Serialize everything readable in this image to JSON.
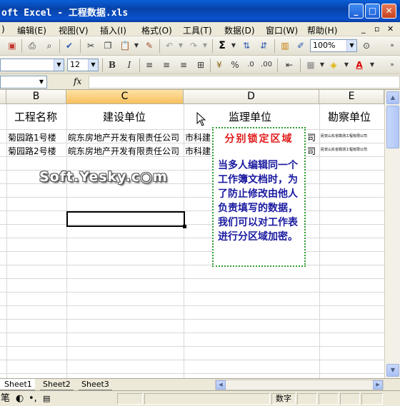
{
  "window": {
    "title": "oft Excel - 工程数据.xls",
    "buttons": [
      "_",
      "□",
      "✕"
    ]
  },
  "menu": {
    "items": [
      "编辑(E)",
      "视图(V)",
      "插入(I)",
      "格式(O)",
      "工具(T)",
      "数据(D)",
      "窗口(W)",
      "帮助(H)"
    ],
    "partial_left": ")",
    "mdi_controls": [
      "_",
      "▫",
      "✕"
    ]
  },
  "toolbar": {
    "zoom": "100%",
    "font_size": "12",
    "sigma": "Σ"
  },
  "formula_bar": {
    "fx": "fx",
    "name_box": "",
    "value": ""
  },
  "columns": [
    "B",
    "C",
    "D",
    "E"
  ],
  "active_column": "C",
  "table": {
    "headers": [
      "工程名称",
      "建设单位",
      "监理单位",
      "勘察单位"
    ],
    "rows": [
      [
        "菊园路1号楼",
        "皖东房地产开发有限责任公司",
        "市科建",
        "司",
        "民安山东省勘测工程有限公司"
      ],
      [
        "菊园路2号楼",
        "皖东房地产开发有限责任公司",
        "市科建",
        "司",
        "民安山东省勘测工程有限公司"
      ]
    ]
  },
  "note": {
    "title": "分别锁定区域",
    "body": "当多人编辑同一个工作簿文档时，为了防止修改由他人负责填写的数据，我们可以对工作表进行分区域加密。"
  },
  "watermark": "Soft.Yesky.c◉m",
  "sheet_tabs": [
    "Sheet1",
    "Sheet2",
    "Sheet3"
  ],
  "active_sheet": "Sheet1",
  "status": {
    "mode": "数字",
    "ime": "笔"
  },
  "colors": {
    "title_bar": "#0842a8",
    "active_header": "#f7c05e",
    "note_title": "#e01818",
    "note_body": "#1a1aa0",
    "note_border": "#2e9b2e"
  }
}
